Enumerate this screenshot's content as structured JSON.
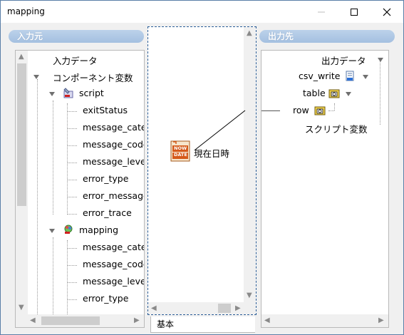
{
  "window": {
    "title": "mapping"
  },
  "left_panel": {
    "header": "入力元",
    "items": [
      {
        "label": "入力データ"
      },
      {
        "label": "コンポーネント変数"
      },
      {
        "label": "script"
      },
      {
        "label": "exitStatus"
      },
      {
        "label": "message_category"
      },
      {
        "label": "message_code"
      },
      {
        "label": "message_level"
      },
      {
        "label": "error_type"
      },
      {
        "label": "error_message"
      },
      {
        "label": "error_trace"
      },
      {
        "label": "mapping"
      },
      {
        "label": "message_category"
      },
      {
        "label": "message_code"
      },
      {
        "label": "message_level"
      },
      {
        "label": "error_type"
      }
    ]
  },
  "center": {
    "node_label": "現在日時",
    "node_icon_text": "NOW DATE",
    "tab_label": "基本"
  },
  "right_panel": {
    "header": "出力先",
    "items": [
      {
        "label": "出力データ"
      },
      {
        "label": "csv_write"
      },
      {
        "label": "table"
      },
      {
        "label": "row"
      },
      {
        "label": "スクリプト変数"
      }
    ]
  },
  "colors": {
    "accent": "#2a5d97",
    "header_bg": "#b0c8e6"
  }
}
